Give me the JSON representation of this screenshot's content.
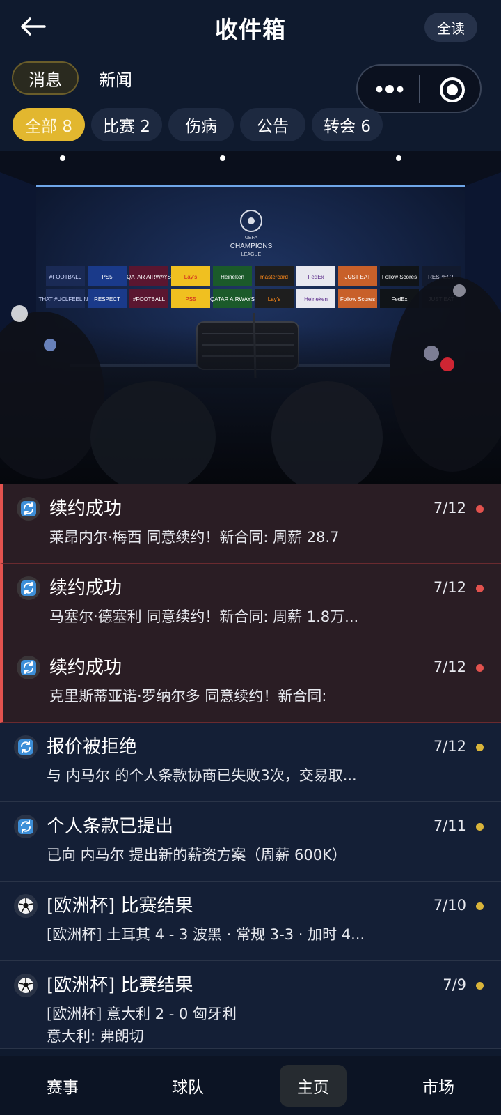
{
  "header": {
    "title": "收件箱",
    "read_all": "全读"
  },
  "tabs": [
    {
      "label": "消息",
      "active": true
    },
    {
      "label": "新闻",
      "active": false
    }
  ],
  "filters": [
    {
      "label": "全部 8",
      "active": true
    },
    {
      "label": "比赛 2",
      "active": false
    },
    {
      "label": "伤病",
      "active": false
    },
    {
      "label": "公告",
      "active": false
    },
    {
      "label": "转会 6",
      "active": false
    }
  ],
  "banner": {
    "emblem_line1": "UEFA",
    "emblem_line2": "CHAMPIONS",
    "emblem_line3": "LEAGUE",
    "sponsors_row1": [
      "#FOOTBALL",
      "PS5",
      "QATAR AIRWAYS",
      "Lay's",
      "Heineken",
      "mastercard",
      "FedEx",
      "JUST EAT",
      "Follow Scores",
      "RESPECT"
    ],
    "sponsors_row2": [
      "THAT #UCLFEELING",
      "RESPECT",
      "#FOOTBALL",
      "PS5",
      "QATAR AIRWAYS",
      "Lay's",
      "Heineken",
      "Follow Scores",
      "FedEx",
      "JUST EAT"
    ]
  },
  "messages": [
    {
      "icon": "transfer-icon",
      "title": "续约成功",
      "body": "莱昂内尔·梅西 同意续约！新合同: 周薪 28.7",
      "body2": "",
      "date": "7/12",
      "unread": true
    },
    {
      "icon": "transfer-icon",
      "title": "续约成功",
      "body": "马塞尔·德塞利 同意续约！新合同: 周薪 1.8万...",
      "body2": "",
      "date": "7/12",
      "unread": true
    },
    {
      "icon": "transfer-icon",
      "title": "续约成功",
      "body": "克里斯蒂亚诺·罗纳尔多 同意续约！新合同:",
      "body2": "",
      "date": "7/12",
      "unread": true
    },
    {
      "icon": "transfer-icon",
      "title": "报价被拒绝",
      "body": "与 内马尔 的个人条款协商已失败3次，交易取...",
      "body2": "",
      "date": "7/12",
      "unread": false
    },
    {
      "icon": "transfer-icon",
      "title": "个人条款已提出",
      "body": "已向 内马尔 提出新的薪资方案（周薪 600K）",
      "body2": "",
      "date": "7/11",
      "unread": false
    },
    {
      "icon": "soccer-ball-icon",
      "title": "[欧洲杯] 比赛结果",
      "body": "[欧洲杯] 土耳其 4 - 3 波黑 · 常规 3-3 · 加时 4...",
      "body2": "",
      "date": "7/10",
      "unread": false
    },
    {
      "icon": "soccer-ball-icon",
      "title": "[欧洲杯] 比赛结果",
      "body": "[欧洲杯] 意大利 2 - 0 匈牙利",
      "body2": "意大利: 弗朗切",
      "date": "7/9",
      "unread": false
    }
  ],
  "bottom_nav": [
    {
      "label": "赛事",
      "active": false
    },
    {
      "label": "球队",
      "active": false
    },
    {
      "label": "主页",
      "active": true
    },
    {
      "label": "市场",
      "active": false
    }
  ],
  "colors": {
    "accent": "#e2b72f",
    "unread_dot": "#e2524e",
    "read_dot": "#d9b43a",
    "background": "#0f1a2e"
  }
}
